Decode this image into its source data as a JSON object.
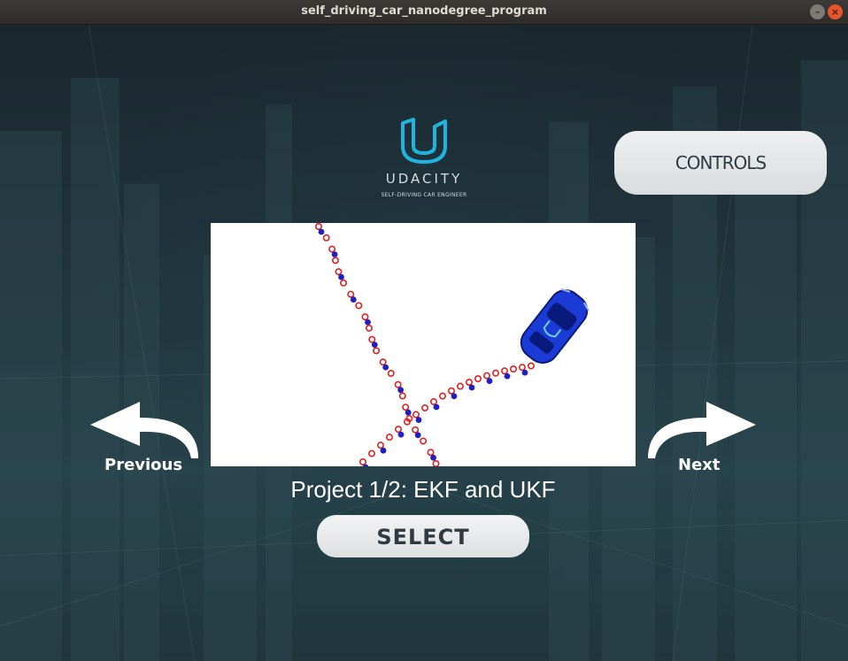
{
  "window": {
    "title": "self_driving_car_nanodegree_program",
    "minimize_glyph": "–",
    "close_glyph": "×"
  },
  "logo": {
    "icon": "udacity-u-icon",
    "wordmark": "UDACITY",
    "tagline": "SELF-DRIVING CAR ENGINEER",
    "accent_color": "#1fb4e0"
  },
  "controls": {
    "label": "CONTROLS"
  },
  "carousel": {
    "previous_label": "Previous",
    "next_label": "Next",
    "project_caption": "Project 1/2: EKF and UKF",
    "select_label": "SELECT",
    "preview_icons": [
      "blue-car-icon",
      "red-measurement-marker",
      "blue-estimate-marker"
    ]
  },
  "colors": {
    "background": "#1f2d35",
    "measurement_marker": "#e02020",
    "estimate_marker": "#2020c0",
    "car": "#1a3bd6"
  }
}
